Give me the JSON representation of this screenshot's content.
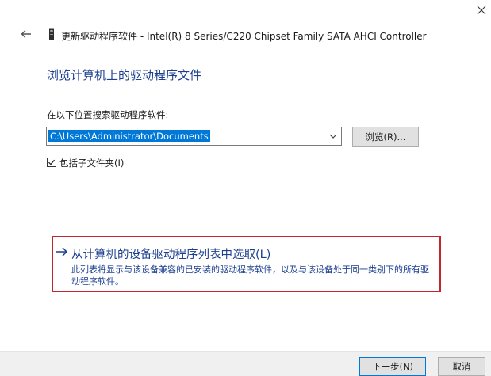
{
  "window": {
    "title": "更新驱动程序软件 - Intel(R) 8 Series/C220 Chipset Family SATA AHCI Controller"
  },
  "main": {
    "heading": "浏览计算机上的驱动程序文件",
    "search_label": "在以下位置搜索驱动程序软件:",
    "path_value": "C:\\Users\\Administrator\\Documents",
    "browse_label": "浏览(R)...",
    "include_subfolders_label": "包括子文件夹(I)",
    "include_subfolders_checked": true
  },
  "pick_option": {
    "title": "从计算机的设备驱动程序列表中选取(L)",
    "description": "此列表将显示与该设备兼容的已安装的驱动程序软件，以及与该设备处于同一类别下的所有驱动程序软件。"
  },
  "footer": {
    "next_label": "下一步(N)",
    "cancel_label": "取消"
  },
  "icons": {
    "close": "close-icon",
    "back": "back-arrow-icon",
    "device": "device-icon",
    "dropdown": "chevron-down-icon",
    "check": "checkmark-icon",
    "option_arrow": "right-arrow-icon"
  },
  "colors": {
    "link_blue": "#1c3f8f",
    "selection_blue": "#0078d7",
    "highlight_red": "#c1272d"
  }
}
